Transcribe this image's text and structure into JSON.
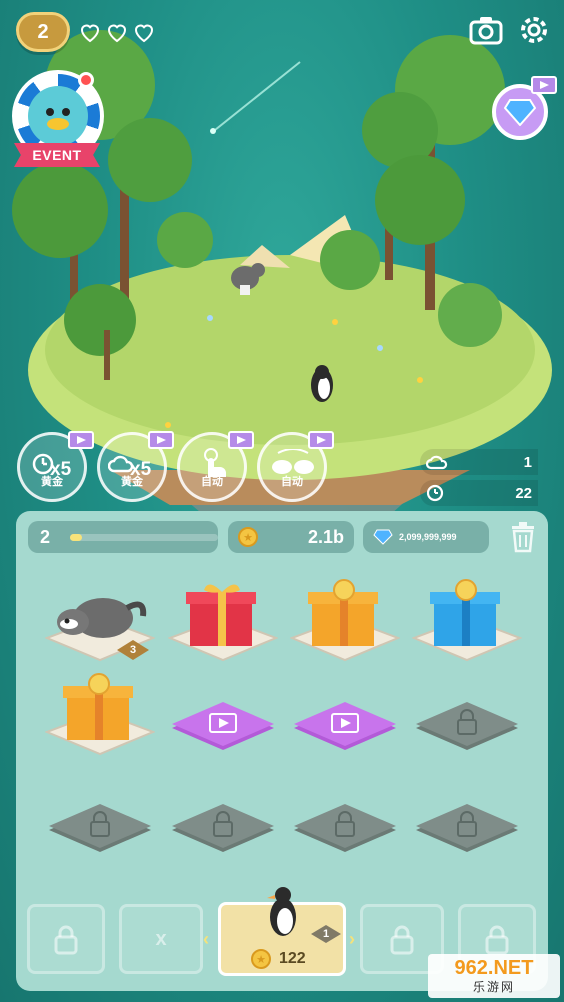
{
  "hud": {
    "level": "2",
    "lives_total": 3,
    "event_label": "EVENT"
  },
  "boosts": [
    {
      "id": "gold-x5-home",
      "multiplier": "x5",
      "label": "黄金"
    },
    {
      "id": "gold-x5-cloud",
      "multiplier": "x5",
      "label": "黄金"
    },
    {
      "id": "auto-tap",
      "label": "自动"
    },
    {
      "id": "auto-merge",
      "label": "自动"
    }
  ],
  "stats": {
    "clouds": "1",
    "time": "22"
  },
  "panel": {
    "level": "2",
    "xp_progress": 0.08,
    "coins": "2.1b",
    "gems": "2,099,999,999"
  },
  "grid": [
    {
      "type": "raccoon",
      "level_badge": "3"
    },
    {
      "type": "gift-red"
    },
    {
      "type": "gift-orange"
    },
    {
      "type": "gift-blue"
    },
    {
      "type": "gift-orange"
    },
    {
      "type": "video"
    },
    {
      "type": "video"
    },
    {
      "type": "locked"
    },
    {
      "type": "locked"
    },
    {
      "type": "locked"
    },
    {
      "type": "locked"
    },
    {
      "type": "locked"
    }
  ],
  "shop": {
    "second_slot_label": "x",
    "buy_level": "1",
    "buy_price": "122"
  },
  "watermark": {
    "brand": "962.NET",
    "sub": "乐游网"
  },
  "colors": {
    "background": "#1f8f86",
    "panel": "#a5d9cf",
    "accent_gold": "#f4c542",
    "gem": "#c79bf4"
  }
}
